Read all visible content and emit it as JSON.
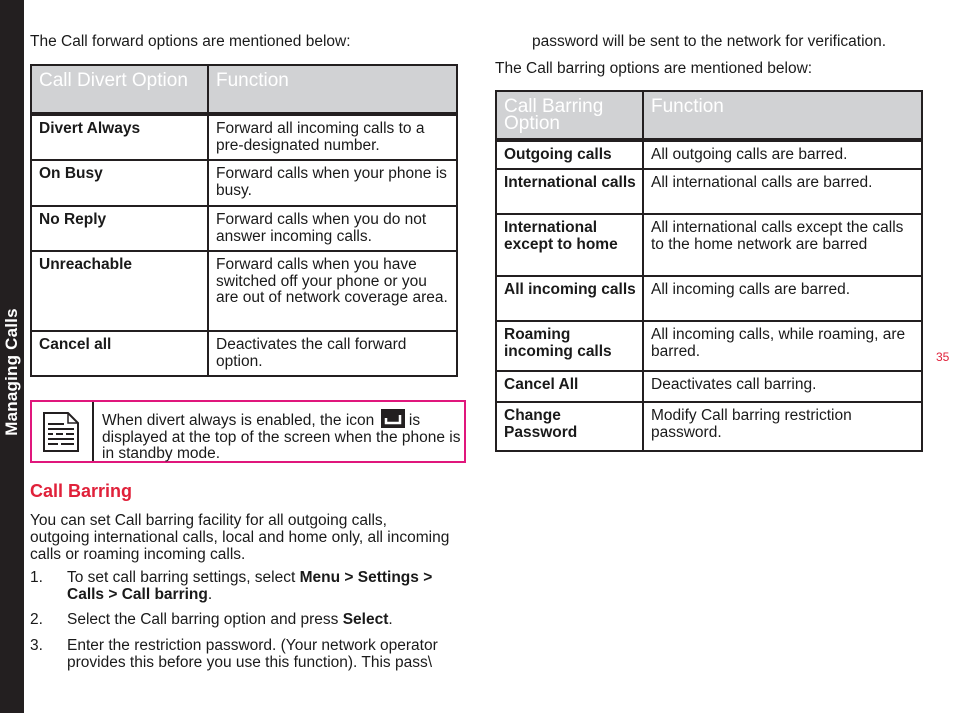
{
  "side_tab": {
    "label": "Managing Calls"
  },
  "page_number": "35",
  "left": {
    "intro": "The Call forward options are mentioned below:",
    "forward_table": {
      "headers": [
        "Call Divert Option",
        "Function"
      ],
      "rows": [
        {
          "option": "Divert Always",
          "function": "Forward all incoming calls to a pre-designated number."
        },
        {
          "option": "On Busy",
          "function": "Forward calls when your phone is busy."
        },
        {
          "option": "No Reply",
          "function": "Forward calls when you do not answer incoming calls."
        },
        {
          "option": "Unreachable",
          "function": "Forward calls when you have switched off your phone or you are out of network coverage area."
        },
        {
          "option": "Cancel all",
          "function": "Deactivates the call forward option."
        }
      ]
    },
    "note": {
      "icon": "note-document-icon",
      "text_before_icon": "When divert always is enabled, the icon",
      "inline_icon": "divert-icon",
      "text_after_icon": "is displayed at the top of the screen when the phone is in standby mode."
    },
    "section_heading": "Call Barring",
    "section_body": "You can set Call barring facility for all outgoing calls, outgoing international calls, local and home only, all incoming calls or roaming incoming calls.",
    "steps": [
      {
        "num": "1.",
        "parts": [
          {
            "text": "To set call barring settings, select ",
            "bold": false
          },
          {
            "text": "Menu > Settings > Calls > Call barring",
            "bold": true
          },
          {
            "text": ".",
            "bold": false
          }
        ]
      },
      {
        "num": "2.",
        "parts": [
          {
            "text": "Select the Call barring option and press ",
            "bold": false
          },
          {
            "text": "Select",
            "bold": true
          },
          {
            "text": ".",
            "bold": false
          }
        ]
      },
      {
        "num": "3.",
        "parts": [
          {
            "text": "Enter the restriction password. (Your network operator provides this before you use this function). This pass\\",
            "bold": false
          }
        ]
      }
    ]
  },
  "right": {
    "continued": "password will be sent to the network for verification.",
    "intro": "The Call barring options are mentioned below:",
    "barring_table": {
      "headers": [
        "Call Barring Option",
        "Function"
      ],
      "rows": [
        {
          "option": "Outgoing calls",
          "function": "All outgoing calls are barred."
        },
        {
          "option": "International calls",
          "function": "All international calls are barred."
        },
        {
          "option": "International except to home",
          "function": "All international calls except the calls to the home network are barred"
        },
        {
          "option": "All incoming calls",
          "function": "All incoming calls are barred."
        },
        {
          "option": "Roaming incoming calls",
          "function": "All incoming calls, while roaming, are barred."
        },
        {
          "option": "Cancel All",
          "function": "Deactivates call barring."
        },
        {
          "option": "Change Password",
          "function": "Modify Call barring restriction password."
        }
      ]
    }
  },
  "colors": {
    "accent_red": "#e0213a",
    "note_border": "#e0177c",
    "header_gray": "#d1d2d4",
    "side_tab": "#231f20"
  }
}
